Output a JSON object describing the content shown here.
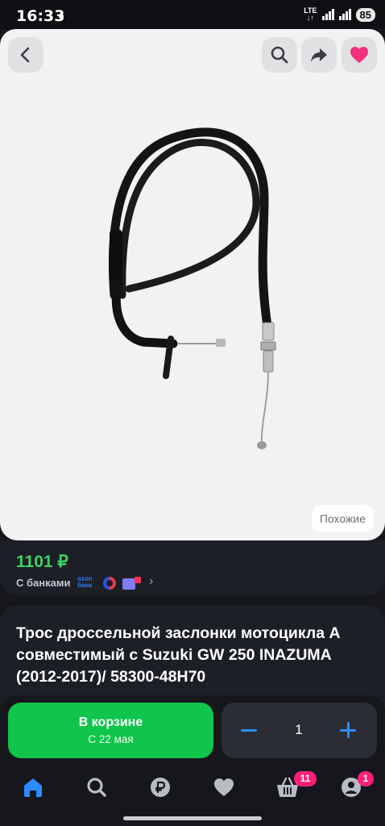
{
  "status_bar": {
    "time": "16:33",
    "network": "LTE",
    "battery": "85"
  },
  "image_area": {
    "similar_label": "Похожие"
  },
  "price_block": {
    "price": "1101 ₽",
    "banks_label": "С банками",
    "bank_badges": [
      "ozon банк"
    ]
  },
  "product": {
    "title": "Трос дроссельной заслонки мотоцикла А совместимый с Suzuki GW 250 INAZUMA (2012-2017)/ 58300-48H70"
  },
  "purchase": {
    "cart_label": "В корзине",
    "delivery_date": "С 22 мая",
    "quantity": "1"
  },
  "tabbar": {
    "cart_badge": "11",
    "profile_badge": "1"
  },
  "colors": {
    "accent_green": "#10c44c",
    "price_green": "#3fd164",
    "accent_blue": "#2c8cff",
    "badge_pink": "#ff1f7a",
    "favorite_pink": "#f5307a",
    "background": "#15171c"
  },
  "icons": [
    "back-arrow-icon",
    "search-icon",
    "share-icon",
    "heart-icon",
    "home-icon",
    "search-icon",
    "ruble-icon",
    "heart-icon",
    "basket-icon",
    "profile-icon",
    "chevron-right-icon",
    "minus-icon",
    "plus-icon"
  ]
}
